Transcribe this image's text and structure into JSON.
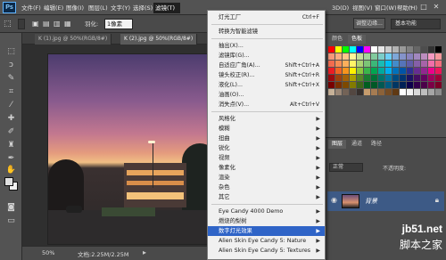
{
  "app": {
    "logo": "Ps"
  },
  "menubar": {
    "items": [
      "文件(F)",
      "编辑(E)",
      "图像(I)",
      "图层(L)",
      "文字(Y)",
      "选择(S)",
      "滤镜(T)",
      "3D(D)",
      "视图(V)",
      "窗口(W)",
      "帮助(H)"
    ],
    "active_index": 6
  },
  "options": {
    "feather_label": "羽化:",
    "feather_value": "1像素",
    "adjust_edge": "调整边缘...",
    "workspace": "基本功能"
  },
  "tabs": [
    {
      "label": "K (1).jpg @ 50%(RGB/8#)",
      "active": false
    },
    {
      "label": "K (2).jpg @ 50%(RGB/8#)",
      "active": true
    }
  ],
  "status": {
    "zoom": "50%",
    "doc": "文档:2.25M/2.25M"
  },
  "panels": {
    "top_tabs": [
      "颜色",
      "色板"
    ],
    "layers_tabs": [
      "图层",
      "通道",
      "路径"
    ],
    "mode": "正常",
    "opacity_label": "不透明度:",
    "layer_name": "背景"
  },
  "filter_menu": {
    "items": [
      {
        "label": "灯光工厂",
        "shortcut": "Ctrl+F"
      },
      {
        "sep": true
      },
      {
        "label": "转换为智能滤镜"
      },
      {
        "sep": true
      },
      {
        "label": "抽出(X)..."
      },
      {
        "label": "滤镜库(G)..."
      },
      {
        "label": "自适应广角(A)...",
        "shortcut": "Shift+Ctrl+A"
      },
      {
        "label": "镜头校正(R)...",
        "shortcut": "Shift+Ctrl+R"
      },
      {
        "label": "液化(L)...",
        "shortcut": "Shift+Ctrl+X"
      },
      {
        "label": "油画(O)..."
      },
      {
        "label": "消失点(V)...",
        "shortcut": "Alt+Ctrl+V"
      },
      {
        "sep": true
      },
      {
        "label": "风格化",
        "sub": true
      },
      {
        "label": "模糊",
        "sub": true
      },
      {
        "label": "扭曲",
        "sub": true
      },
      {
        "label": "锐化",
        "sub": true
      },
      {
        "label": "视频",
        "sub": true
      },
      {
        "label": "像素化",
        "sub": true
      },
      {
        "label": "渲染",
        "sub": true
      },
      {
        "label": "杂色",
        "sub": true
      },
      {
        "label": "其它",
        "sub": true
      },
      {
        "sep": true
      },
      {
        "label": "Eye Candy 4000 Demo",
        "sub": true
      },
      {
        "label": "燃烧的梨树",
        "sub": true
      },
      {
        "label": "数字灯光效果",
        "sub": true,
        "highlight": true
      },
      {
        "label": "Alien Skin Eye Candy 5: Nature",
        "sub": true
      },
      {
        "label": "Alien Skin Eye Candy 5: Textures",
        "sub": true
      }
    ]
  },
  "watermark": {
    "url": "jb51.net",
    "text": "脚本之家"
  },
  "colors": {
    "accent": "#2f64c7",
    "menu_bg": "#f0f0f0"
  }
}
